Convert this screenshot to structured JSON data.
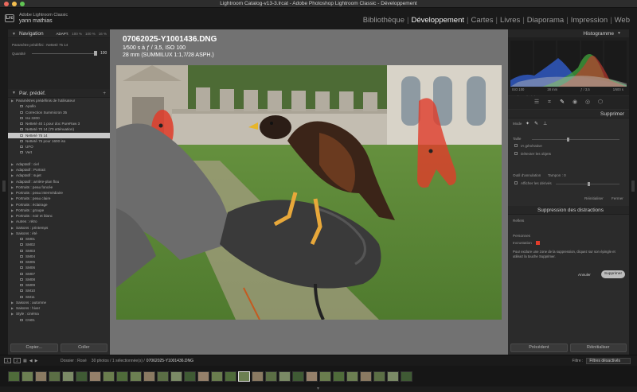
{
  "window": {
    "title": "Lightroom Catalog-v13-3.lrcat - Adobe Photoshop Lightroom Classic - Développement"
  },
  "identity": {
    "logo": "Lrc",
    "app_name": "Adobe Lightroom Classic",
    "user_name": "yann mathias"
  },
  "modules": [
    "Bibliothèque",
    "Développement",
    "Cartes",
    "Livres",
    "Diaporama",
    "Impression",
    "Web"
  ],
  "active_module": "Développement",
  "navigator": {
    "title": "Navigation",
    "zoom_options": [
      "ADAPT.",
      "100 %",
      "100 %",
      "16 %"
    ],
    "preset_line": "Paramètre prédéfini : Netteté 75 14",
    "quantity_label": "Quantité",
    "quantity_value": "100"
  },
  "presets": {
    "title": "Par. prédéf.",
    "items": [
      {
        "label": "Paramètres prédéfinis de l'utilisateur",
        "level": "group"
      },
      {
        "label": "Apollo",
        "level": "child"
      },
      {
        "label": "Correction Summicron 35",
        "level": "child"
      },
      {
        "label": "Iso 3200",
        "level": "child"
      },
      {
        "label": "Netteté 40 1 pour doc PureRaw 3",
        "level": "child"
      },
      {
        "label": "Netteté 70 14 (70 atténuation)",
        "level": "child"
      },
      {
        "label": "Netteté 75 14",
        "level": "child",
        "selected": true
      },
      {
        "label": "Netteté 75 pour 1600 iso",
        "level": "child"
      },
      {
        "label": "UFO",
        "level": "child"
      },
      {
        "label": "Vert",
        "level": "child"
      },
      {
        "label": "",
        "level": "spacer"
      },
      {
        "label": "Adaptatif : ciel",
        "level": "group"
      },
      {
        "label": "Adaptatif : Portrait",
        "level": "group"
      },
      {
        "label": "Adaptatif : sujet",
        "level": "group"
      },
      {
        "label": "Adaptatif : arrière-plan flou",
        "level": "group"
      },
      {
        "label": "Portraits : peau foncée",
        "level": "group"
      },
      {
        "label": "Portraits : peau intermédiaire",
        "level": "group"
      },
      {
        "label": "Portraits : peau claire",
        "level": "group"
      },
      {
        "label": "Portraits : éclairage",
        "level": "group"
      },
      {
        "label": "Portraits : groupe",
        "level": "group"
      },
      {
        "label": "Portraits : noir et blanc",
        "level": "group"
      },
      {
        "label": "Autres : rétro",
        "level": "group"
      },
      {
        "label": "Saisons : printemps",
        "level": "group"
      },
      {
        "label": "Saisons : été",
        "level": "group"
      },
      {
        "label": "SM01",
        "level": "child"
      },
      {
        "label": "SM02",
        "level": "child"
      },
      {
        "label": "SM03",
        "level": "child"
      },
      {
        "label": "SM04",
        "level": "child"
      },
      {
        "label": "SM05",
        "level": "child"
      },
      {
        "label": "SM06",
        "level": "child"
      },
      {
        "label": "SM07",
        "level": "child"
      },
      {
        "label": "SM08",
        "level": "child"
      },
      {
        "label": "SM09",
        "level": "child"
      },
      {
        "label": "SM10",
        "level": "child"
      },
      {
        "label": "SM11",
        "level": "child"
      },
      {
        "label": "Saisons : automne",
        "level": "group"
      },
      {
        "label": "Saisons : hiver",
        "level": "group"
      },
      {
        "label": "Style : cinéma",
        "level": "group"
      },
      {
        "label": "CN01",
        "level": "child"
      }
    ],
    "copy_button": "Copier...",
    "paste_button": "Coller"
  },
  "photo_info": {
    "filename": "07062025-Y1001436.DNG",
    "exposure": "1⁄500 s à ƒ / 3,5, ISO 100",
    "lens": "28 mm (SUMMILUX 1:1,7/28 ASPH.)"
  },
  "histogram": {
    "title": "Histogramme",
    "readout": [
      "ISO 100",
      "28 mm",
      "ƒ / 3,5",
      "1⁄500 s"
    ],
    "original_photo": "Photo d'origine"
  },
  "remove_panel": {
    "title": "Supprimer",
    "mode_label": "Mode",
    "size_label": "Taille",
    "generative_label": "IA générative",
    "detect_objects_label": "Détecter les objets",
    "opacity_label": "Outil d'annulation",
    "opacity_value": "Tampon : 0",
    "show_effects_label": "Afficher les dérivés",
    "reset_label": "Réinitialiser",
    "close_label": "Fermer"
  },
  "distractions_panel": {
    "title": "Suppression des distractions",
    "reflections_label": "Reflets",
    "people_label": "Personnes",
    "overlay_label": "Incrustation",
    "overlay_color": "#e03c2a",
    "note": "Pour exclure une zone de la suppression, cliquez sur son épingle et utilisez la touche Supprimer.",
    "show_button": "Annuler",
    "delete_button": "Supprimer"
  },
  "right_buttons": {
    "previous": "Précédent",
    "reset": "Réinitialiser"
  },
  "filmstrip_bar": {
    "page1": "1",
    "page2": "2",
    "folder": "Dossier : Rosé",
    "count": "30 photos / 1 sélectionnée(s) /",
    "current": "07062025-Y1001436.DNG",
    "filter_label": "Filtre :",
    "filter_value": "Filtres désactivés"
  },
  "colors": {
    "panel_bg": "#2b2b2b",
    "center_bg": "#727272",
    "mask_red": "#e03c2a",
    "accent_active": "#f2f2f2"
  }
}
